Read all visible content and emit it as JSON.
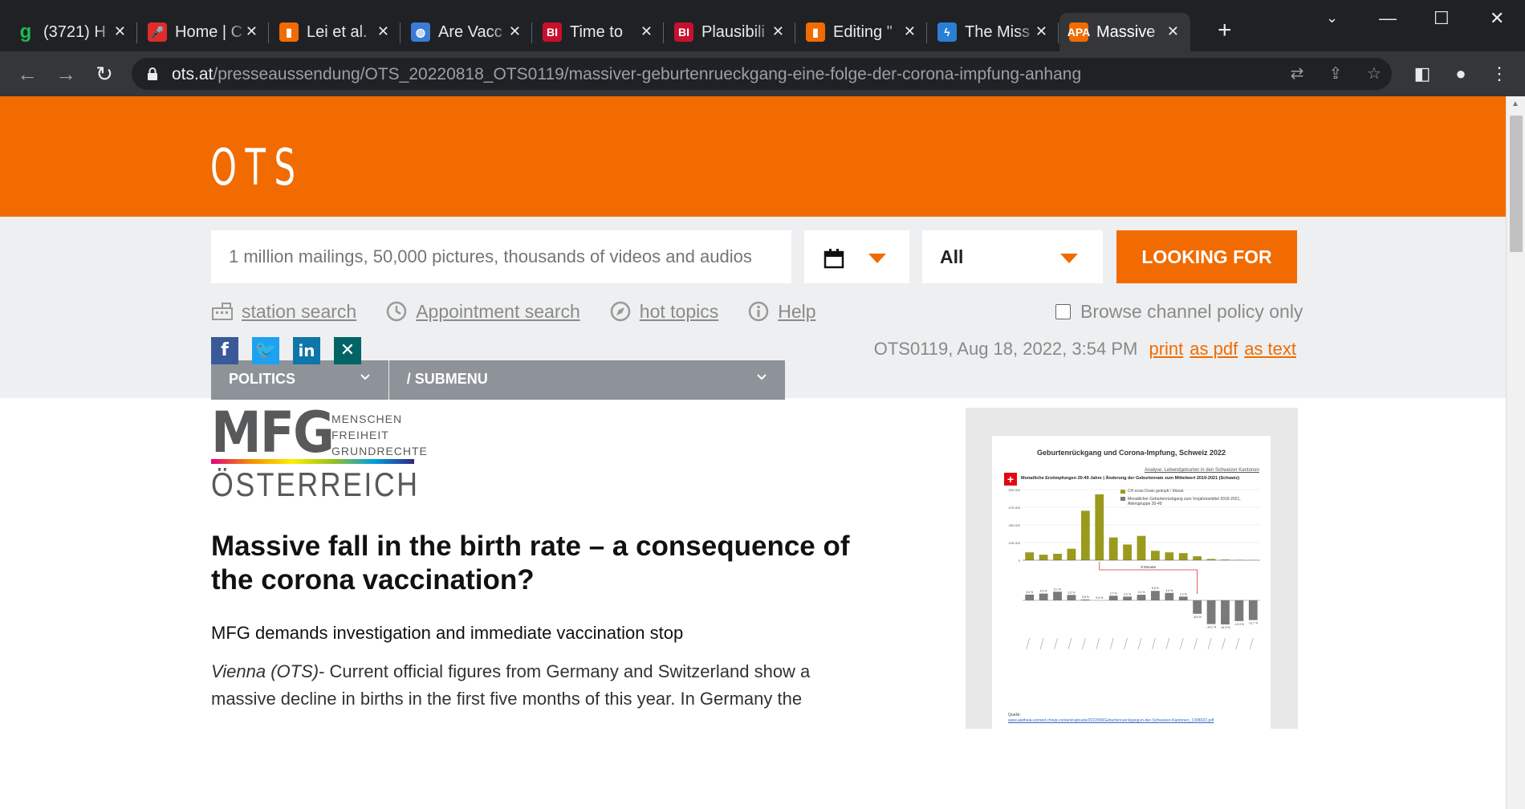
{
  "browser": {
    "tabs": [
      {
        "title": "(3721) H",
        "favicon_color": "#1db954",
        "favicon_glyph": "g"
      },
      {
        "title": "Home | C",
        "favicon_color": "#e02b2b",
        "favicon_glyph": "mic-icon"
      },
      {
        "title": "Lei et al.",
        "favicon_color": "#f16b00",
        "favicon_glyph": "bookmark-icon"
      },
      {
        "title": "Are Vacc",
        "favicon_color": "#3a7bd5",
        "favicon_glyph": "globe-icon"
      },
      {
        "title": "Time to",
        "favicon_color": "#c8102e",
        "favicon_glyph": "BI"
      },
      {
        "title": "Plausibili",
        "favicon_color": "#c8102e",
        "favicon_glyph": "BI"
      },
      {
        "title": "Editing \"",
        "favicon_color": "#f16b00",
        "favicon_glyph": "bookmark-icon"
      },
      {
        "title": "The Miss",
        "favicon_color": "#2a7fd4",
        "favicon_glyph": "lightning-icon"
      },
      {
        "title": "Massive",
        "favicon_color": "#f16b00",
        "favicon_glyph": "APA"
      }
    ],
    "active_tab": 8,
    "url_host": "ots.at",
    "url_path": "/presseaussendung/OTS_20220818_OTS0119/massiver-geburtenrueckgang-eine-folge-der-corona-impfung-anhang"
  },
  "site": {
    "logo": "OTS",
    "brand_color": "#f16b00",
    "search_placeholder": "1 million mailings, 50,000 pictures, thousands of videos and audios",
    "category_select": "All",
    "search_button": "LOOKING FOR",
    "quick_links": [
      {
        "label": "station search",
        "icon": "building-icon"
      },
      {
        "label": "Appointment search",
        "icon": "clock-icon"
      },
      {
        "label": "hot topics",
        "icon": "compass-icon"
      },
      {
        "label": "Help",
        "icon": "info-icon"
      }
    ],
    "policy_checkbox_label": "Browse channel policy only",
    "menu": {
      "primary": "POLITICS",
      "secondary": "/ SUBMENU"
    }
  },
  "article": {
    "meta_id_date": "OTS0119, Aug 18, 2022, 3:54 PM",
    "links": [
      "print",
      "as pdf",
      "as text"
    ],
    "sender_logo": {
      "big": "MFG",
      "lines": [
        "MENSCHEN",
        "FREIHEIT",
        "GRUNDRECHTE"
      ],
      "country": "ÖSTERREICH"
    },
    "headline": "Massive fall in the birth rate – a consequence of the corona vaccination?",
    "subheadline": "MFG demands investigation and immediate vaccination stop",
    "body_dateline": "Vienna (OTS)",
    "body_text": "- Current official figures from Germany and Switzerland show a massive decline in births in the first five months of this year. In Germany the"
  },
  "chart_data": {
    "type": "bar",
    "title": "Geburtenrückgang und Corona-Impfung, Schweiz 2022",
    "subtitle": "Monatliche Erstimpfungen 20-49 Jahre | Änderung der Geburtenrate zum Mittelwert 2019-2021 (Schweiz)",
    "annotation": "Analyse: Lebendgeburten in den Schweizer Kantonen",
    "series": [
      {
        "name": "CH erste Dosis geimpft / Monat",
        "color": "#9a9a1e",
        "values": [
          50,
          35,
          41,
          73,
          315,
          420,
          145,
          100,
          155,
          60,
          50,
          45,
          25,
          8,
          4,
          2,
          0.8
        ]
      },
      {
        "name": "Monatlicher Geburtenrückgang zum Vorjahresmittel 2019-2021, Altersgruppe 20-49",
        "color": "#7a7a7a",
        "values": [
          3.4,
          4.0,
          5.1,
          3.2,
          0.5,
          0.0,
          2.7,
          2.2,
          3.3,
          5.6,
          4.4,
          2.2,
          -8.0,
          -14.1,
          -14.3,
          -12.3,
          -11.7
        ]
      }
    ],
    "tick_labels_y": [
      "900.000",
      "675.000",
      "450.000",
      "225.000",
      "0"
    ],
    "lag_label": "9 Monate",
    "source_label": "Quelle:",
    "source_url": "www.aletheia-scimed.ch/wp-content/uploads/2022/08/Geburtenrueckgang-in-der-Schweizer-Kantonen_1308022.pdf"
  }
}
